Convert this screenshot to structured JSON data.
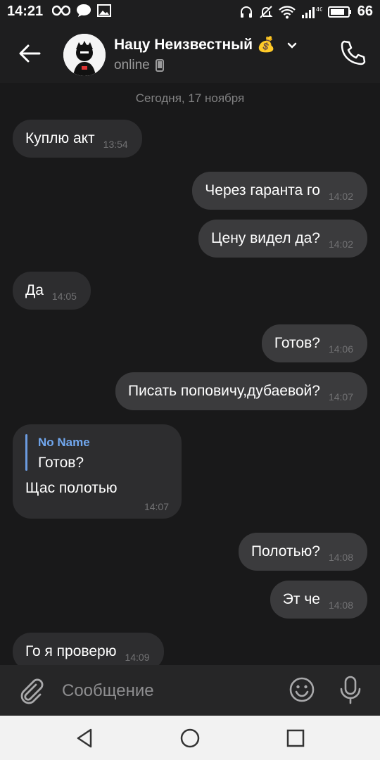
{
  "status_bar": {
    "time": "14:21",
    "battery": "66",
    "network": "4G LTE",
    "left_icons": [
      "infinity-icon",
      "chat-bubble-icon",
      "image-icon"
    ],
    "right_icons": [
      "headphones-icon",
      "mute-icon",
      "wifi-icon",
      "signal-icon",
      "battery-icon"
    ]
  },
  "header": {
    "contact_name": "Нацу Неизвестный",
    "name_emoji": "💰",
    "status": "online"
  },
  "chat": {
    "date_separator": "Сегодня, 17 ноября",
    "messages": [
      {
        "text": "Куплю акт",
        "time": "13:54",
        "direction": "in"
      },
      {
        "text": "Через гаранта го",
        "time": "14:02",
        "direction": "out"
      },
      {
        "text": "Цену видел да?",
        "time": "14:02",
        "direction": "out"
      },
      {
        "text": "Да",
        "time": "14:05",
        "direction": "in"
      },
      {
        "text": "Готов?",
        "time": "14:06",
        "direction": "out"
      },
      {
        "text": "Писать поповичу,дубаевой?",
        "time": "14:07",
        "direction": "out"
      },
      {
        "text": "Полотью?",
        "time": "14:08",
        "direction": "out"
      },
      {
        "text": "Эт че",
        "time": "14:08",
        "direction": "out"
      },
      {
        "text": "Го я проверю",
        "time": "14:09",
        "direction": "in"
      }
    ],
    "reply_message": {
      "quoted_name": "No Name",
      "quoted_text": "Готов?",
      "text": "Щас полотью",
      "time": "14:07",
      "direction": "in"
    }
  },
  "composer": {
    "placeholder": "Сообщение"
  },
  "colors": {
    "background": "#19191a",
    "incoming_bubble": "#2d2d2f",
    "outgoing_bubble": "#3b3b3d",
    "reply_accent": "#71a7ee"
  }
}
